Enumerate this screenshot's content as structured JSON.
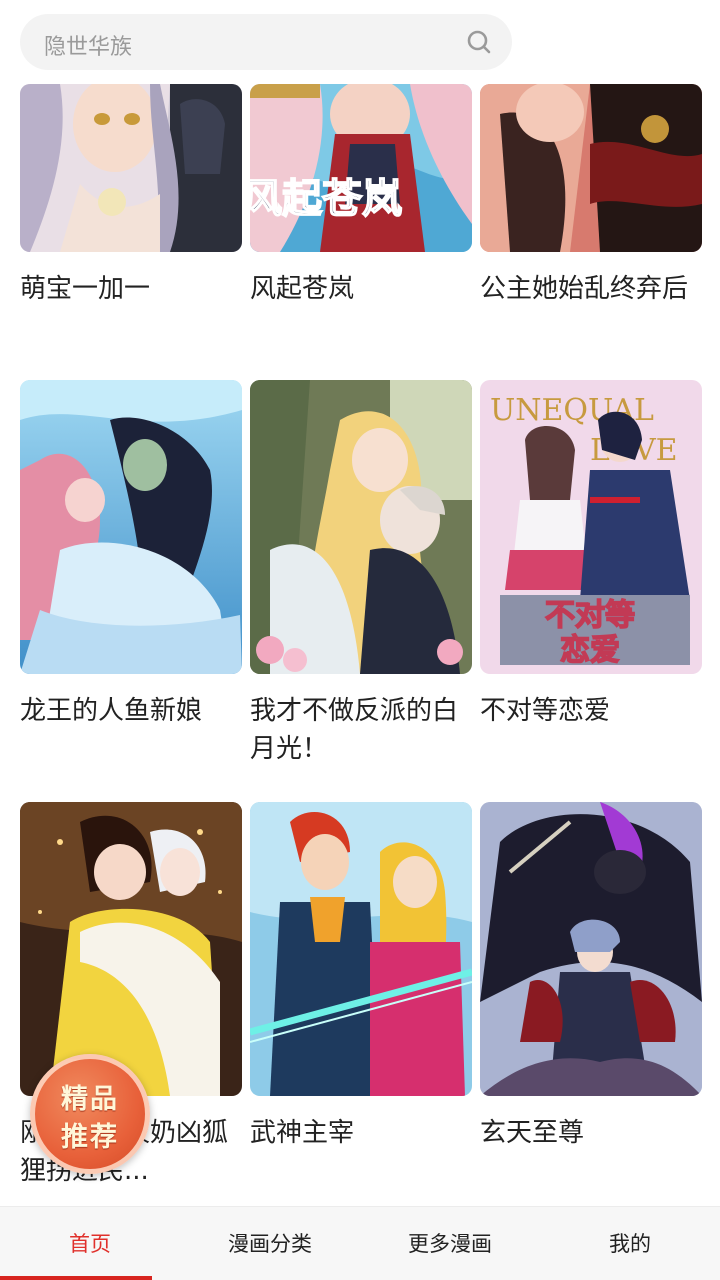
{
  "search": {
    "placeholder": "隐世华族"
  },
  "comics": [
    {
      "title": "萌宝一加一"
    },
    {
      "title": "风起苍岚"
    },
    {
      "title": "公主她始乱终弃后"
    },
    {
      "title": "龙王的人鱼新娘"
    },
    {
      "title": "我才不做反派的白月光！"
    },
    {
      "title": "不对等恋爱"
    },
    {
      "title": "刚穿越就被奶凶狐狸拐进民..."
    },
    {
      "title": "武神主宰"
    },
    {
      "title": "玄天至尊"
    }
  ],
  "cover_text": {
    "c2": "风起苍岚",
    "c6a": "UNEQUAL",
    "c6b": "LOVE",
    "c6c": "不对等",
    "c6d": "恋爱"
  },
  "badge": {
    "line1": "精品",
    "line2": "推荐"
  },
  "tabs": [
    {
      "label": "首页",
      "active": true
    },
    {
      "label": "漫画分类"
    },
    {
      "label": "更多漫画"
    },
    {
      "label": "我的"
    }
  ],
  "colors": {
    "accent": "#e0302b",
    "badge": "#e8613a"
  }
}
